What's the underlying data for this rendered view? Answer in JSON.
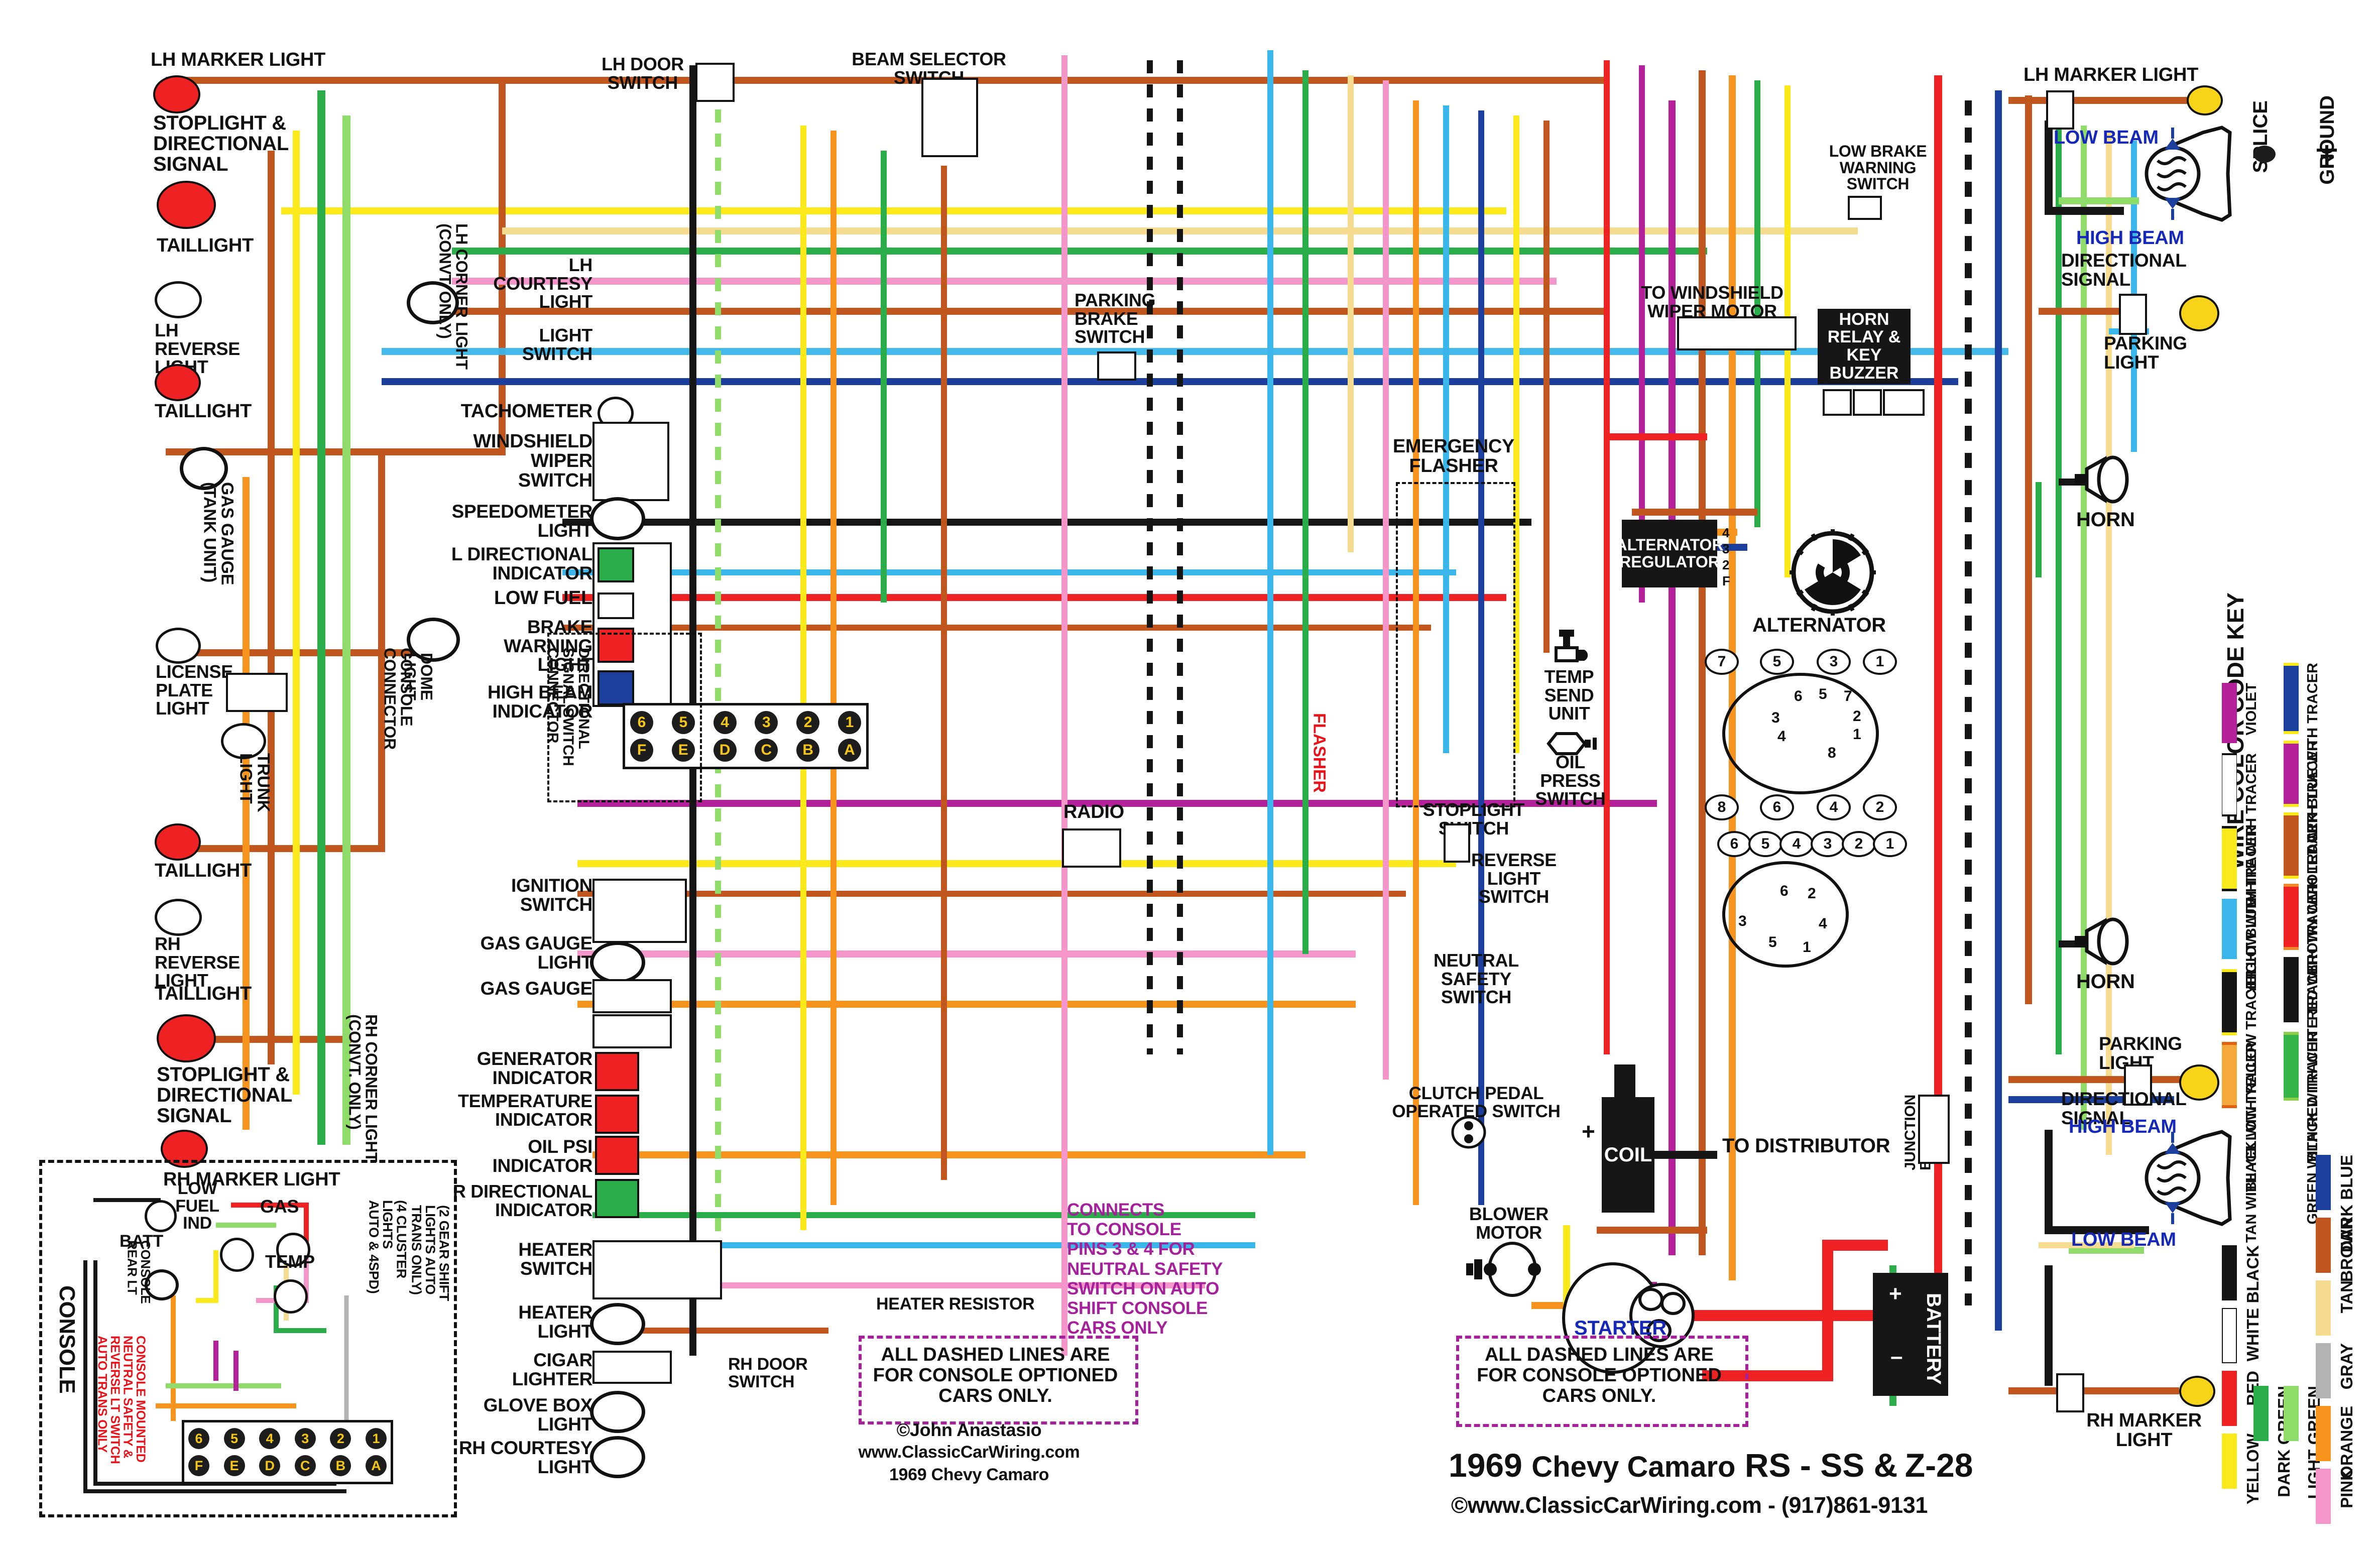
{
  "document": {
    "title": "1969 Chevy Camaro RS - SS & Z-28",
    "title_year": "1969",
    "title_model": "Chevy Camaro",
    "title_trim": "RS - SS &",
    "title_z": "Z-",
    "title_z28": "28",
    "copyright_line": "©www.ClassicCarWiring.com - (917)861-9131",
    "author": "©John Anastasio",
    "author_site": "www.ClassicCarWiring.com",
    "author_model": "1969 Chevy Camaro"
  },
  "notes": {
    "dashed_note_left": "ALL DASHED LINES ARE\nFOR CONSOLE OPTIONED\nCARS ONLY.",
    "dashed_note_right": "ALL DASHED LINES ARE\nFOR CONSOLE OPTIONED\nCARS ONLY.",
    "console_pins_note": "CONNECTS\nTO CONSOLE\nPINS 3 & 4 FOR\nNEUTRAL SAFETY\nSWITCH ON AUTO\nSHIFT CONSOLE\nCARS ONLY",
    "console_mounted_note": "CONSOLE MOUNTED\nNEUTRAL SAFETY &\nREVERSE LT SWITCH\nAUTO TRANS ONLY"
  },
  "rear_left": {
    "lh_marker_light": "LH MARKER LIGHT",
    "stoplight_directional": "STOPLIGHT &\nDIRECTIONAL\nSIGNAL",
    "taillight_1": "TAILLIGHT",
    "lh_reverse_light": "LH\nREVERSE\nLIGHT",
    "taillight_2": "TAILLIGHT",
    "gas_gauge_tank": "GAS GAUGE\n(TANK UNIT)",
    "license_plate_light": "LICENSE\nPLATE\nLIGHT",
    "trunk_light": "TRUNK\nLIGHT",
    "taillight_3": "TAILLIGHT",
    "rh_reverse_light": "RH\nREVERSE\nLIGHT",
    "taillight_4": "TAILLIGHT",
    "stoplight_directional_2": "STOPLIGHT &\nDIRECTIONAL\nSIGNAL",
    "rh_marker_light": "RH MARKER LIGHT",
    "rh_corner_light": "RH CORNER LIGHT\n(CONVT. ONLY)"
  },
  "dash": {
    "lh_corner_light": "LH CORNER LIGHT\n(CONVT. ONLY)",
    "lh_courtesy_light": "LH\nCOURTESY\nLIGHT",
    "light_switch": "LIGHT\nSWITCH",
    "tachometer": "TACHOMETER",
    "windshield_wiper_switch": "WINDSHIELD\nWIPER\nSWITCH",
    "speedometer_light": "SPEEDOMETER\nLIGHT",
    "l_directional_indicator": "L DIRECTIONAL\nINDICATOR",
    "low_fuel": "LOW FUEL",
    "brake_warning_light": "BRAKE\nWARNING\nLIGHT",
    "high_beam_indicator": "HIGH BEAM\nINDICATOR",
    "dome_light": "DOME\nLIGHT",
    "console_connector": "CONSOLE\nCONNECTOR",
    "directional_switch_connector": "DIRECTIONAL\nSIGNAL SWITCH\nCONNECTOR",
    "ignition_switch": "IGNITION\nSWITCH",
    "gas_gauge_light": "GAS GAUGE\nLIGHT",
    "gas_gauge": "GAS GAUGE",
    "generator_indicator": "GENERATOR\nINDICATOR",
    "temperature_indicator": "TEMPERATURE\nINDICATOR",
    "oil_psi_indicator": "OIL PSI\nINDICATOR",
    "r_directional_indicator": "R DIRECTIONAL\nINDICATOR",
    "heater_switch": "HEATER\nSWITCH",
    "heater_light": "HEATER\nLIGHT",
    "cigar_lighter": "CIGAR\nLIGHTER",
    "glove_box_light": "GLOVE BOX\nLIGHT",
    "rh_courtesy_light": "RH COURTESY\nLIGHT",
    "heater_resistor": "HEATER RESISTOR",
    "rh_door_switch": "RH DOOR\nSWITCH",
    "lh_door_switch": "LH DOOR\nSWITCH",
    "beam_selector_switch": "BEAM SELECTOR SWITCH",
    "parking_brake_switch": "PARKING\nBRAKE\nSWITCH",
    "radio": "RADIO",
    "emergency_flasher": "EMERGENCY\nFLASHER",
    "flasher": "FLASHER",
    "low_brake_warning_switch": "LOW BRAKE\nWARNING\nSWITCH"
  },
  "engine": {
    "to_windshield_wiper_motor": "TO WINDSHIELD\nWIPER MOTOR",
    "horn_relay_key_buzzer": "HORN\nRELAY\n& KEY\nBUZZER",
    "alternator_regulator": "ALTERNATOR\nREGULATOR",
    "alternator": "ALTERNATOR",
    "regulator_pins": [
      "4",
      "3",
      "2",
      "F"
    ],
    "temp_send_unit": "TEMP\nSEND\nUNIT",
    "oil_press_switch": "OIL\nPRESS\nSWITCH",
    "stoplight_switch": "STOPLIGHT\nSWITCH",
    "reverse_light_switch": "REVERSE\nLIGHT\nSWITCH",
    "neutral_safety_switch": "NEUTRAL\nSAFETY\nSWITCH",
    "clutch_pedal_switch": "CLUTCH PEDAL\nOPERATED SWITCH",
    "blower_motor": "BLOWER\nMOTOR",
    "coil": "COIL",
    "to_distributor": "TO DISTRIBUTOR",
    "junction_block": "JUNCTION\nBLOCK",
    "battery": "BATTERY",
    "battery_plus": "+",
    "battery_minus": "–",
    "coil_plus": "+",
    "starter": "STARTER",
    "horn_top": "HORN",
    "horn_bottom": "HORN"
  },
  "front_right": {
    "lh_marker_light": "LH MARKER LIGHT",
    "low_beam_top": "LOW BEAM",
    "high_beam_top": "HIGH BEAM",
    "directional_signal_top": "DIRECTIONAL\nSIGNAL",
    "parking_light_top": "PARKING\nLIGHT",
    "parking_light_bottom": "PARKING\nLIGHT",
    "directional_signal_bottom": "DIRECTIONAL\nSIGNAL",
    "high_beam_bottom": "HIGH BEAM",
    "low_beam_bottom": "LOW BEAM",
    "rh_marker_light": "RH MARKER\nLIGHT"
  },
  "console": {
    "title": "CONSOLE",
    "batt": "BATT",
    "low_fuel_ind": "LOW\nFUEL\nIND",
    "gas": "GAS",
    "temp": "TEMP",
    "console_rear_lt": "CONSOLE\nREAR LT",
    "cluster_4": "(4 CLUSTER\nLIGHTS\nAUTO & 4SPD)",
    "cluster_2": "(2 GEAR SHIFT\nLIGHTS AUTO\nTRANS ONLY)",
    "pins_top": [
      "6",
      "5",
      "4",
      "3",
      "2",
      "1"
    ],
    "pins_bottom": [
      "F",
      "E",
      "D",
      "C",
      "B",
      "A"
    ]
  },
  "connectors": {
    "console_connector_pins_top": [
      "6",
      "5",
      "4",
      "3",
      "2",
      "1"
    ],
    "console_connector_pins_bottom": [
      "F",
      "E",
      "D",
      "C",
      "B",
      "A"
    ]
  },
  "distributor_top": {
    "outer_labels": [
      "7",
      "5",
      "3",
      "1",
      "8",
      "6",
      "4",
      "2"
    ],
    "inner_labels": [
      "6",
      "5",
      "7",
      "3",
      "2",
      "4",
      "1",
      "8"
    ]
  },
  "distributor_bottom": {
    "outer_labels": [
      "6",
      "5",
      "4",
      "3",
      "2",
      "1"
    ],
    "inner_labels": [
      "6",
      "2",
      "3",
      "4",
      "5",
      "1"
    ]
  },
  "key": {
    "heading": "WIRE COLOR CODE KEY",
    "splice_label": "SPLICE",
    "ground_label": "GROUND",
    "col1": [
      {
        "name": "VIOLET",
        "color": "#b4219b",
        "tracer": null
      },
      {
        "name": "WHITE WITH TRACER",
        "color": "#ffffff",
        "tracer": "#111111"
      },
      {
        "name": "YELLOW WITH TRACER",
        "color": "#fbe91b",
        "tracer": "#111111"
      },
      {
        "name": "LIGHT BLUE",
        "color": "#3ab6ea",
        "tracer": null
      },
      {
        "name": "BLACK WITH YELLOW TRACER",
        "color": "#161616",
        "tracer": "#fbe91b"
      },
      {
        "name": "TAN WITH YELLOW TRACER",
        "color": "#f5a93a",
        "tracer": "#e2620f"
      }
    ],
    "col2": [
      {
        "name": "DARK BLUE WITH  TRACER",
        "color": "#1c3f9e",
        "tracer": "#fbe91b"
      },
      {
        "name": "VIOLET WITH TRACER",
        "color": "#b4219b",
        "tracer": "#fbe91b"
      },
      {
        "name": "BROWN WITH TRACER",
        "color": "#c1561e",
        "tracer": "#fbe91b"
      },
      {
        "name": "RED WITH TRACER",
        "color": "#ee2222",
        "tracer": "#f0892b"
      },
      {
        "name": "BLACK WITH WHITE TRACER",
        "color": "#161616",
        "tracer": "#ffffff"
      },
      {
        "name": "GREEN WITH RED TRACER",
        "color": "#36b54a",
        "tracer": "#8cd04a"
      }
    ],
    "col3": [
      {
        "name": "BLACK",
        "color": "#161616",
        "tracer": null
      },
      {
        "name": "WHITE",
        "color": "#ffffff",
        "tracer": null
      },
      {
        "name": "RED",
        "color": "#ee2222",
        "tracer": null
      },
      {
        "name": "YELLOW",
        "color": "#fbe91b",
        "tracer": null
      },
      {
        "name": "DARK GREEN",
        "color": "#2bae4a",
        "tracer": null
      },
      {
        "name": "LIGHT GREEN",
        "color": "#8fdc6a",
        "tracer": null
      }
    ],
    "col4": [
      {
        "name": "DARK BLUE",
        "color": "#1c3f9e",
        "tracer": null
      },
      {
        "name": "BROWN",
        "color": "#c1561e",
        "tracer": null
      },
      {
        "name": "TAN",
        "color": "#f6dc90",
        "tracer": null
      },
      {
        "name": "GRAY",
        "color": "#b3b3b3",
        "tracer": null
      },
      {
        "name": "ORANGE",
        "color": "#f7941e",
        "tracer": null
      },
      {
        "name": "PINK",
        "color": "#f596cb",
        "tracer": null
      }
    ]
  },
  "colors": {
    "red": "#ee2222",
    "brown": "#c1561e",
    "orange": "#f7941e",
    "yellow": "#fbe91b",
    "dark_green": "#2bae4a",
    "light_green": "#8fdc6a",
    "light_blue": "#3ab6ea",
    "dark_blue": "#1c3f9e",
    "violet": "#b4219b",
    "pink": "#f596cb",
    "gray": "#b3b3b3",
    "tan": "#f6dc90",
    "black": "#161616",
    "white": "#ffffff",
    "title_red": "#e8131b",
    "label_blue": "#1528b8"
  }
}
